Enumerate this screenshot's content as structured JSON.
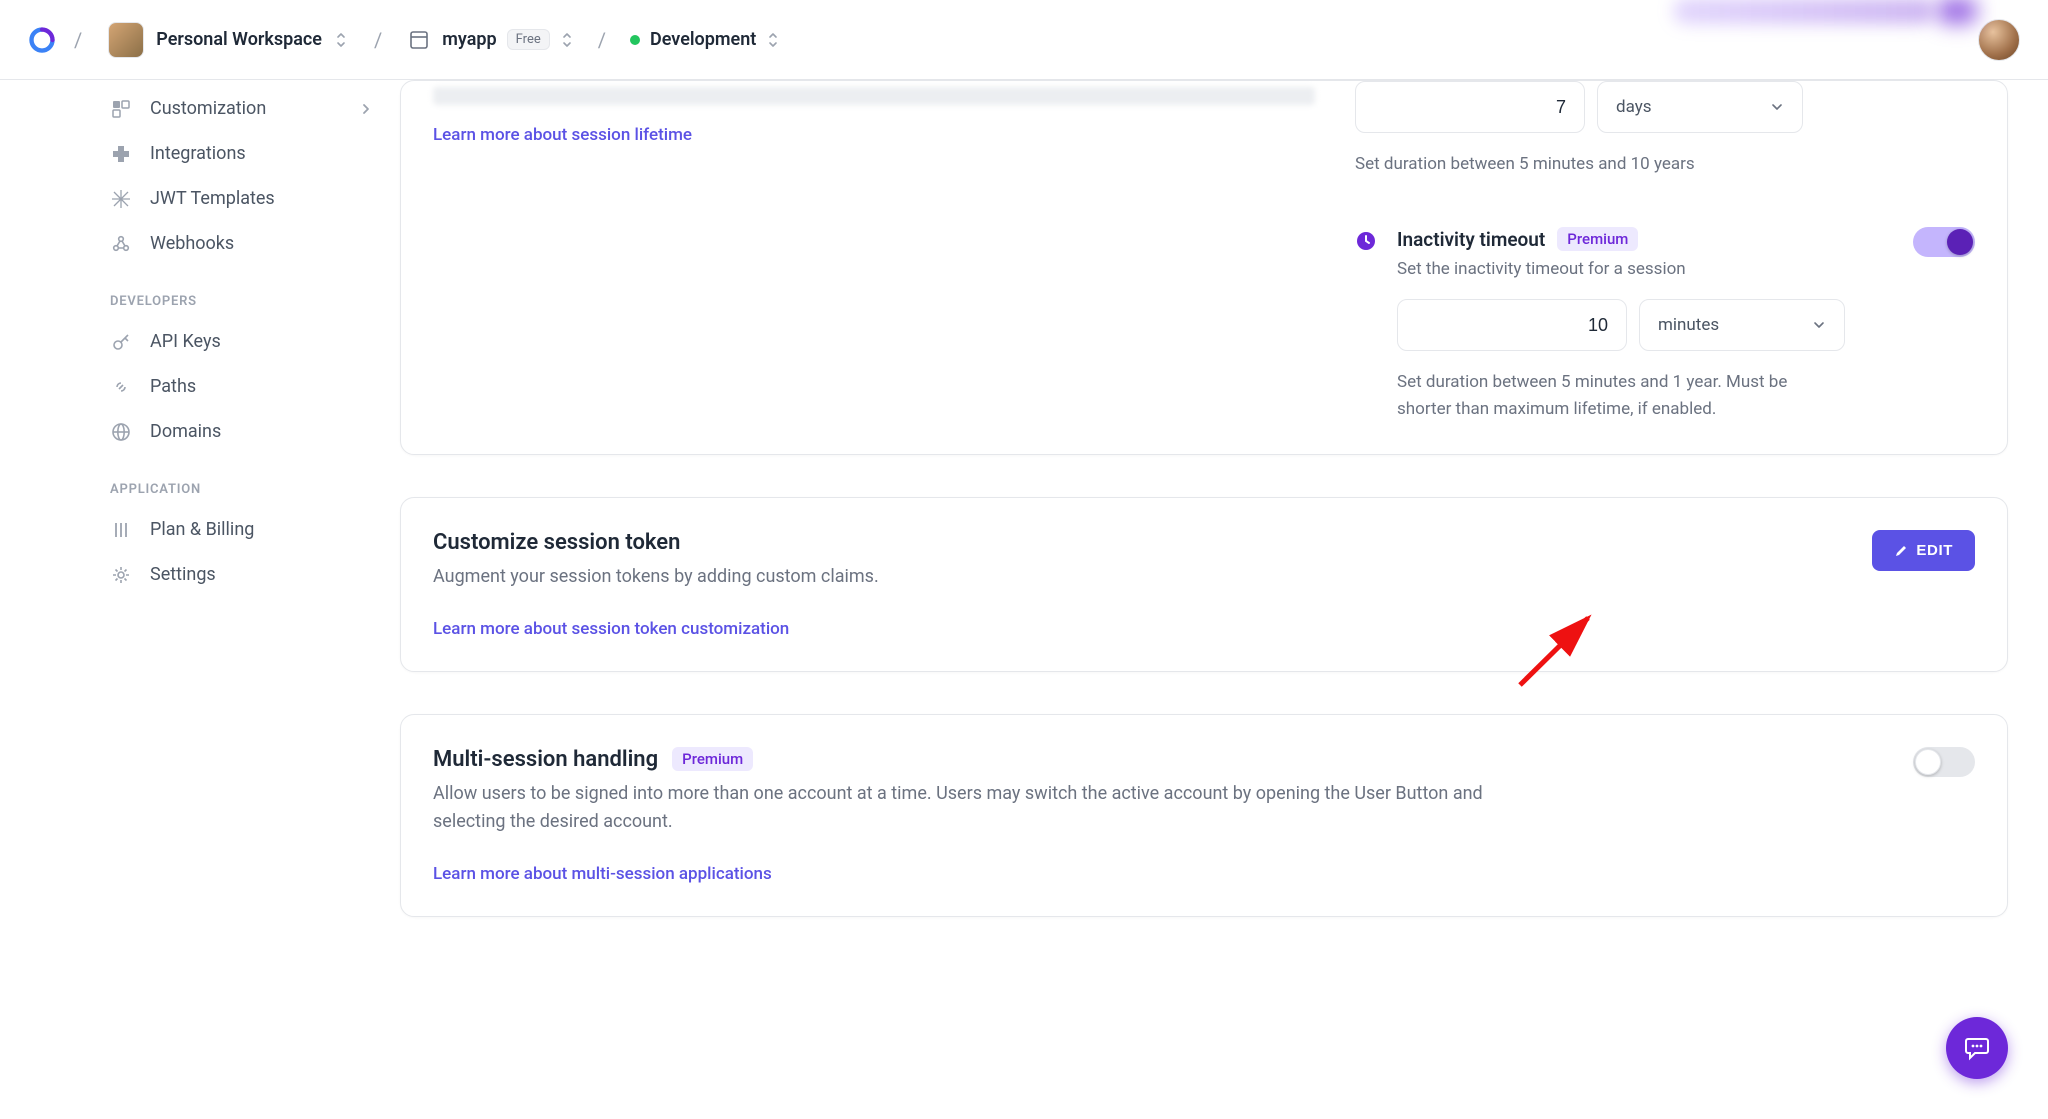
{
  "header": {
    "workspace": "Personal Workspace",
    "app_name": "myapp",
    "app_plan": "Free",
    "environment": "Development"
  },
  "sidebar": {
    "items_ungrouped": [
      {
        "id": "customization",
        "label": "Customization",
        "icon": "customization-icon",
        "has_submenu": true
      },
      {
        "id": "integrations",
        "label": "Integrations",
        "icon": "integrations-icon"
      },
      {
        "id": "jwt",
        "label": "JWT Templates",
        "icon": "jwt-icon"
      },
      {
        "id": "webhooks",
        "label": "Webhooks",
        "icon": "webhooks-icon"
      }
    ],
    "group_developers": {
      "title": "Developers",
      "items": [
        {
          "id": "apikeys",
          "label": "API Keys",
          "icon": "key-icon"
        },
        {
          "id": "paths",
          "label": "Paths",
          "icon": "link-icon"
        },
        {
          "id": "domains",
          "label": "Domains",
          "icon": "globe-icon"
        }
      ]
    },
    "group_application": {
      "title": "Application",
      "items": [
        {
          "id": "planbilling",
          "label": "Plan & Billing",
          "icon": "billing-icon"
        },
        {
          "id": "settings",
          "label": "Settings",
          "icon": "gear-icon"
        }
      ]
    }
  },
  "lifetime": {
    "learn_link": "Learn more about session lifetime",
    "max_value": "7",
    "max_unit": "days",
    "max_helper": "Set duration between 5 minutes and 10 years",
    "inactivity": {
      "title": "Inactivity timeout",
      "premium": "Premium",
      "desc": "Set the inactivity timeout for a session",
      "value": "10",
      "unit": "minutes",
      "helper": "Set duration between 5 minutes and 1 year. Must be shorter than maximum lifetime, if enabled.",
      "enabled": true
    }
  },
  "customize_token": {
    "title": "Customize session token",
    "desc": "Augment your session tokens by adding custom claims.",
    "link": "Learn more about session token customization",
    "edit_label": "EDIT"
  },
  "multi_session": {
    "title": "Multi-session handling",
    "premium": "Premium",
    "desc": "Allow users to be signed into more than one account at a time. Users may switch the active account by opening the User Button and selecting the desired account.",
    "link": "Learn more about multi-session applications",
    "enabled": false
  },
  "colors": {
    "accent": "#5b52e5",
    "premium_bg": "#ede9fe",
    "premium_fg": "#6d28d9"
  }
}
